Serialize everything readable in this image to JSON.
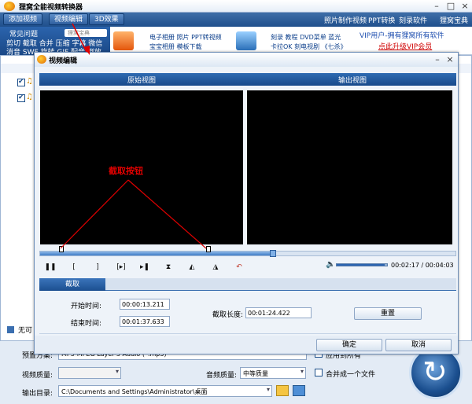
{
  "app": {
    "title": "狸窝全能视频转换器"
  },
  "menubar": {
    "add_video": "添加视频",
    "video_edit": "视频编辑",
    "effect_3d": "3D效果",
    "links": [
      "照片制作视频",
      "PPT转换",
      "刻录软件",
      "狸窝宝典"
    ]
  },
  "banner": {
    "faq_title": "常见问题",
    "faq_search": "狸窝宝典",
    "faq_line1": "剪切 截取 合并 压缩 字幕 微信",
    "faq_line2": "消音 SWF 旋转 GIF 配音 倒放",
    "group1_line1": "电子相册 照片 PPT转视频",
    "group1_line2": "宝宝相册 模板下载",
    "group2_line1": "刻录 教程 DVD菜单 蓝光",
    "group2_line2": "卡拉OK 刻电视剧 《七杀》",
    "vip_line1": "VIP用户-拥有狸窝所有软件",
    "vip_line2": "点此升级VIP会员"
  },
  "list": {
    "status_text": "无可"
  },
  "bottom": {
    "preset_label": "预置方案:",
    "preset_value": "MP3-MPEG Layer-3 Audio (*.mp3)",
    "apply_all": "应用到所有",
    "video_quality_label": "视频质量:",
    "video_quality_value": "",
    "audio_quality_label": "音频质量:",
    "audio_quality_value": "中等质量",
    "merge_label": "合并成一个文件",
    "output_label": "输出目录:",
    "output_value": "C:\\Documents and Settings\\Administrator\\桌面"
  },
  "dialog": {
    "title": "视频编辑",
    "orig_view": "原始视图",
    "output_view": "输出视图",
    "time_display": "00:02:17 / 00:04:03",
    "tab_crop": "截取",
    "start_time_label": "开始时间:",
    "start_time": "00:00:13.211",
    "end_time_label": "结束时间:",
    "end_time": "00:01:37.633",
    "crop_length_label": "截取长度:",
    "crop_length": "00:01:24.422",
    "reset": "重置",
    "ok": "确定",
    "cancel": "取消",
    "progress": 0.56,
    "volume": 0.95
  },
  "annotation": {
    "text": "截取按钮",
    "color": "#e00000"
  }
}
